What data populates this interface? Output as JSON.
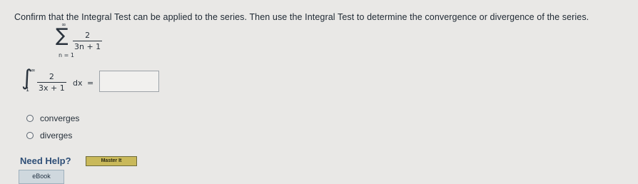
{
  "question": {
    "text": "Confirm that the Integral Test can be applied to the series. Then use the Integral Test to determine the convergence or divergence of the series."
  },
  "series": {
    "sigma_symbol": "∑",
    "upper_limit": "∞",
    "lower_limit": "n = 1",
    "numerator": "2",
    "denominator": "3n + 1"
  },
  "integral": {
    "symbol": "∫",
    "upper_limit": "∞",
    "lower_limit": "1",
    "numerator": "2",
    "denominator": "3x + 1",
    "differential": "dx",
    "equals": "=",
    "answer_value": ""
  },
  "choices": [
    {
      "label": "converges"
    },
    {
      "label": "diverges"
    }
  ],
  "help": {
    "label": "Need Help?",
    "master_button": "Master It"
  },
  "ebook": {
    "label": "eBook"
  }
}
